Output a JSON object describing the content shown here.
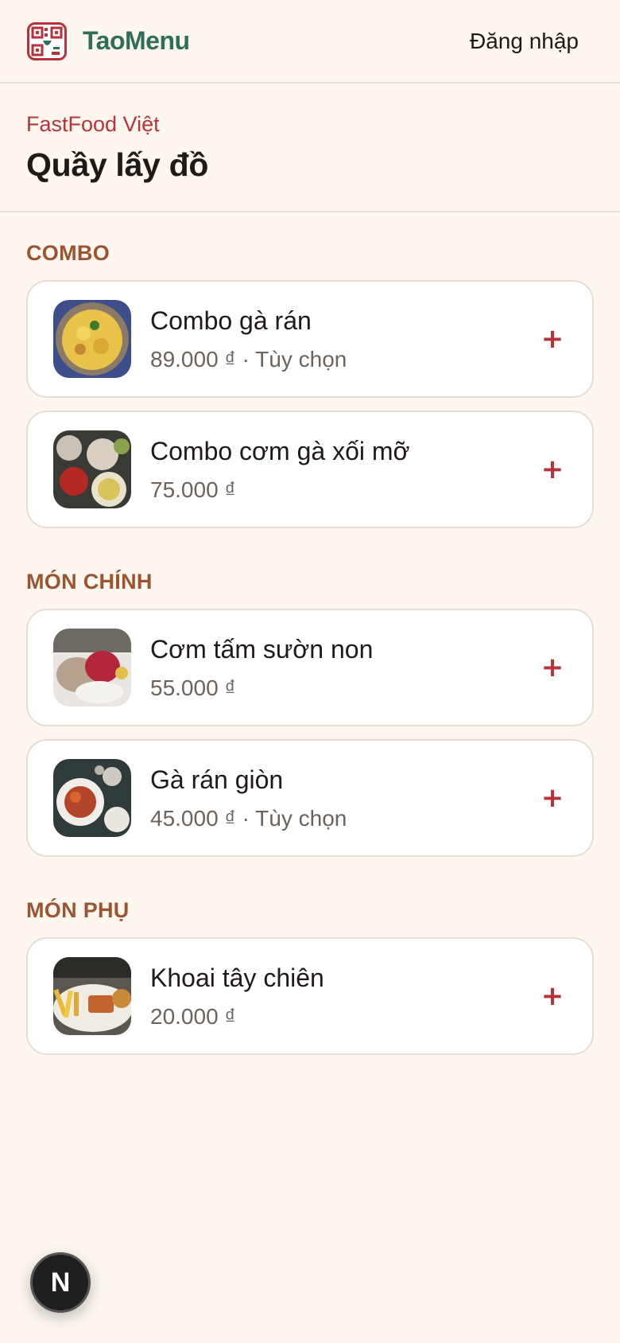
{
  "header": {
    "brand": "TaoMenu",
    "login_label": "Đăng nhập"
  },
  "store": {
    "restaurant_name": "FastFood Việt",
    "counter_name": "Quầy lấy đồ"
  },
  "sections": [
    {
      "title": "COMBO",
      "items": [
        {
          "name": "Combo gà rán",
          "price": "89.000 ₫ · Tùy chọn"
        },
        {
          "name": "Combo cơm gà xối mỡ",
          "price": "75.000 ₫"
        }
      ]
    },
    {
      "title": "MÓN CHÍNH",
      "items": [
        {
          "name": "Cơm tấm sườn non",
          "price": "55.000 ₫"
        },
        {
          "name": "Gà rán giòn",
          "price": "45.000 ₫ · Tùy chọn"
        }
      ]
    },
    {
      "title": "MÓN PHỤ",
      "items": [
        {
          "name": "Khoai tây chiên",
          "price": "20.000 ₫"
        }
      ]
    }
  ],
  "add_symbol": "+",
  "fab_label": "N",
  "colors": {
    "background": "#fdf7f0",
    "brand_green": "#2f6e58",
    "accent_red": "#b7323a",
    "section_brown": "#9a5530"
  }
}
